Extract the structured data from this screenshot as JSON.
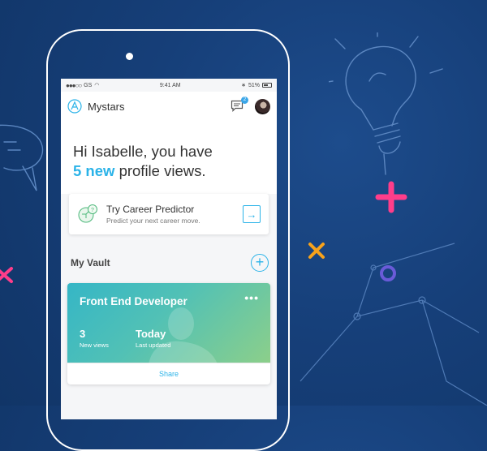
{
  "status_bar": {
    "carrier": "GS",
    "time": "9:41 AM",
    "battery": "51%"
  },
  "app_bar": {
    "title": "Mystars",
    "message_badge": "2"
  },
  "greeting": {
    "line1": "Hi Isabelle, you have",
    "count": "5 new",
    "line2_rest": "profile views."
  },
  "predictor": {
    "title": "Try Career Predictor",
    "subtitle": "Predict your next career move."
  },
  "vault": {
    "title": "My Vault",
    "card": {
      "title": "Front End Developer",
      "more": "•••",
      "views_value": "3",
      "views_label": "New views",
      "updated_value": "Today",
      "updated_label": "Last updated",
      "share_label": "Share"
    }
  },
  "colors": {
    "accent": "#2bb3e8",
    "background": "#163f79",
    "pink": "#ff3d8a",
    "orange": "#f7a21b",
    "purple": "#6a5bd8"
  }
}
